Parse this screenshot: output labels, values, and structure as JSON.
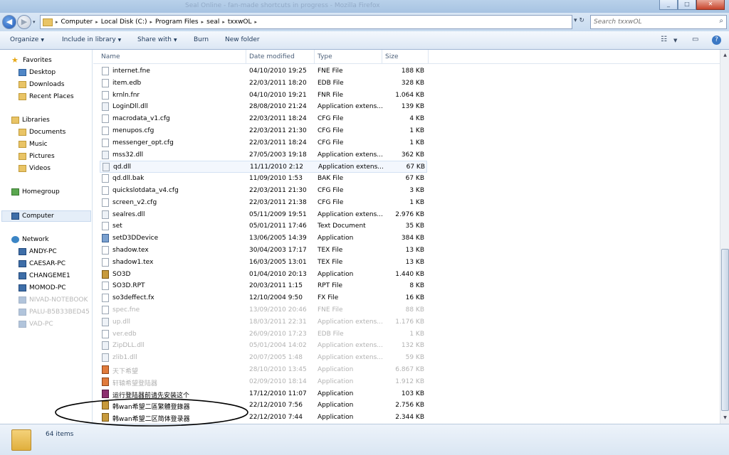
{
  "window": {
    "caption": "Seal Online - fan-made shortcuts in progress - Mozilla Firefox",
    "btn_min": "_",
    "btn_max": "□",
    "btn_close": "✕"
  },
  "address": {
    "crumbs": [
      "Computer",
      "Local Disk (C:)",
      "Program Files",
      "seal",
      "txxwOL"
    ],
    "separator": "▸",
    "refresh": "↻",
    "dropdown": "▾"
  },
  "search": {
    "placeholder": "Search txxwOL",
    "icon": "⌕"
  },
  "toolbar": {
    "organize": "Organize",
    "include_in_library": "Include in library",
    "share_with": "Share with",
    "burn": "Burn",
    "new_folder": "New folder",
    "views": "☷",
    "help": "?"
  },
  "navpane": {
    "favorites": "Favorites",
    "desktop": "Desktop",
    "downloads": "Downloads",
    "recent_places": "Recent Places",
    "libraries": "Libraries",
    "documents": "Documents",
    "music": "Music",
    "pictures": "Pictures",
    "videos": "Videos",
    "homegroup": "Homegroup",
    "computer": "Computer",
    "network": "Network",
    "network_items": [
      "ANDY-PC",
      "CAESAR-PC",
      "CHANGEME1",
      "MOMOD-PC",
      "NIVAD-NOTEBOOK",
      "PALU-B5B33BED45",
      "VAD-PC"
    ]
  },
  "columns": {
    "name": "Name",
    "date": "Date modified",
    "type": "Type",
    "size": "Size"
  },
  "files": [
    {
      "name": "internet.fne",
      "date": "04/10/2010 19:25",
      "type": "FNE File",
      "size": "188 KB",
      "icon": "file"
    },
    {
      "name": "item.edb",
      "date": "22/03/2011 18:20",
      "type": "EDB File",
      "size": "328 KB",
      "icon": "file"
    },
    {
      "name": "krnln.fnr",
      "date": "04/10/2010 19:21",
      "type": "FNR File",
      "size": "1.064 KB",
      "icon": "file"
    },
    {
      "name": "LoginDll.dll",
      "date": "28/08/2010 21:24",
      "type": "Application extens...",
      "size": "139 KB",
      "icon": "dll"
    },
    {
      "name": "macrodata_v1.cfg",
      "date": "22/03/2011 18:24",
      "type": "CFG File",
      "size": "4 KB",
      "icon": "file"
    },
    {
      "name": "menupos.cfg",
      "date": "22/03/2011 21:30",
      "type": "CFG File",
      "size": "1 KB",
      "icon": "file"
    },
    {
      "name": "messenger_opt.cfg",
      "date": "22/03/2011 18:24",
      "type": "CFG File",
      "size": "1 KB",
      "icon": "file"
    },
    {
      "name": "mss32.dll",
      "date": "27/05/2003 19:18",
      "type": "Application extens...",
      "size": "362 KB",
      "icon": "dll"
    },
    {
      "name": "qd.dll",
      "date": "11/11/2010 2:12",
      "type": "Application extens...",
      "size": "67 KB",
      "icon": "dll"
    },
    {
      "name": "qd.dll.bak",
      "date": "11/09/2010 1:53",
      "type": "BAK File",
      "size": "67 KB",
      "icon": "file"
    },
    {
      "name": "quickslotdata_v4.cfg",
      "date": "22/03/2011 21:30",
      "type": "CFG File",
      "size": "3 KB",
      "icon": "file"
    },
    {
      "name": "screen_v2.cfg",
      "date": "22/03/2011 21:38",
      "type": "CFG File",
      "size": "1 KB",
      "icon": "file"
    },
    {
      "name": "sealres.dll",
      "date": "05/11/2009 19:51",
      "type": "Application extens...",
      "size": "2.976 KB",
      "icon": "dll"
    },
    {
      "name": "set",
      "date": "05/01/2011 17:46",
      "type": "Text Document",
      "size": "35 KB",
      "icon": "file"
    },
    {
      "name": "setD3DDevice",
      "date": "13/06/2005 14:39",
      "type": "Application",
      "size": "384 KB",
      "icon": "app"
    },
    {
      "name": "shadow.tex",
      "date": "30/04/2003 17:17",
      "type": "TEX File",
      "size": "13 KB",
      "icon": "file"
    },
    {
      "name": "shadow1.tex",
      "date": "16/03/2005 13:01",
      "type": "TEX File",
      "size": "13 KB",
      "icon": "file"
    },
    {
      "name": "SO3D",
      "date": "01/04/2010 20:13",
      "type": "Application",
      "size": "1.440 KB",
      "icon": "game"
    },
    {
      "name": "SO3D.RPT",
      "date": "20/03/2011 1:15",
      "type": "RPT File",
      "size": "8 KB",
      "icon": "file"
    },
    {
      "name": "so3deffect.fx",
      "date": "12/10/2004 9:50",
      "type": "FX File",
      "size": "16 KB",
      "icon": "file"
    },
    {
      "name": "spec.fne",
      "date": "13/09/2010 20:46",
      "type": "FNE File",
      "size": "88 KB",
      "icon": "file"
    },
    {
      "name": "up.dll",
      "date": "18/03/2011 22:31",
      "type": "Application extens...",
      "size": "1.176 KB",
      "icon": "dll"
    },
    {
      "name": "ver.edb",
      "date": "26/09/2010 17:23",
      "type": "EDB File",
      "size": "1 KB",
      "icon": "file"
    },
    {
      "name": "ZipDLL.dll",
      "date": "05/01/2004 14:02",
      "type": "Application extens...",
      "size": "132 KB",
      "icon": "dll"
    },
    {
      "name": "zlib1.dll",
      "date": "20/07/2005 1:48",
      "type": "Application extens...",
      "size": "59 KB",
      "icon": "dll"
    },
    {
      "name": "天下希望",
      "date": "28/10/2010 13:45",
      "type": "Application",
      "size": "6.867 KB",
      "icon": "chn"
    },
    {
      "name": "轩辕希望登陆器",
      "date": "02/09/2010 18:14",
      "type": "Application",
      "size": "1.912 KB",
      "icon": "chn"
    },
    {
      "name": "运行登陆器前请先安装这个",
      "date": "17/12/2010 11:07",
      "type": "Application",
      "size": "103 KB",
      "icon": "rar"
    },
    {
      "name": "韩wan希望二區繁體登錄器",
      "date": "22/12/2010 7:56",
      "type": "Application",
      "size": "2.756 KB",
      "icon": "game"
    },
    {
      "name": "韩wan希望二区简体登录器",
      "date": "22/12/2010 7:44",
      "type": "Application",
      "size": "2.344 KB",
      "icon": "game"
    }
  ],
  "status": {
    "count": "64 items"
  },
  "scroll": {
    "up": "▲",
    "down": "▼"
  }
}
